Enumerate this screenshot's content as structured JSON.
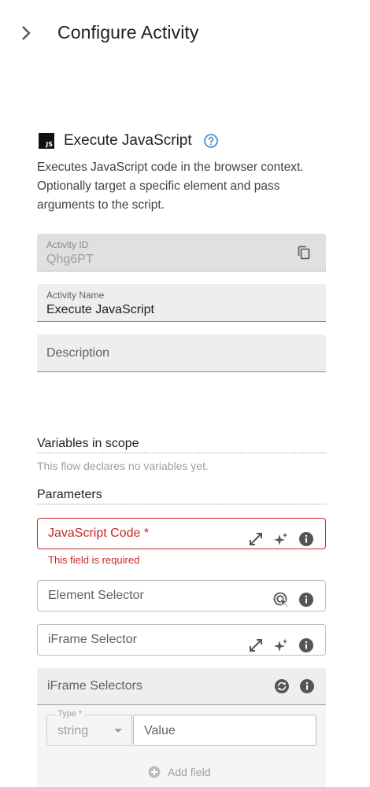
{
  "header": {
    "title": "Configure Activity",
    "back_icon": "chevron-right-icon"
  },
  "activity": {
    "logo_text": "JS",
    "title": "Execute JavaScript",
    "description": "Executes JavaScript code in the browser context. Optionally target a specific element and pass arguments to the script."
  },
  "fields": {
    "activity_id": {
      "label": "Activity ID",
      "value": "Qhg6PT"
    },
    "activity_name": {
      "label": "Activity Name",
      "value": "Execute JavaScript"
    },
    "description": {
      "placeholder": "Description"
    }
  },
  "variables": {
    "title": "Variables in scope",
    "hint": "This flow declares no variables yet."
  },
  "parameters": {
    "title": "Parameters",
    "js_code": {
      "label": "JavaScript Code *",
      "error": "This field is required"
    },
    "element_selector": {
      "label": "Element Selector"
    },
    "iframe_selector": {
      "label": "iFrame Selector"
    },
    "iframe_selectors": {
      "title": "iFrame Selectors",
      "type_label": "Type *",
      "type_value": "string",
      "value_placeholder": "Value",
      "add_label": "Add field"
    }
  },
  "colors": {
    "error": "#c62828",
    "help": "#4a8fd4",
    "icon": "#555555"
  }
}
